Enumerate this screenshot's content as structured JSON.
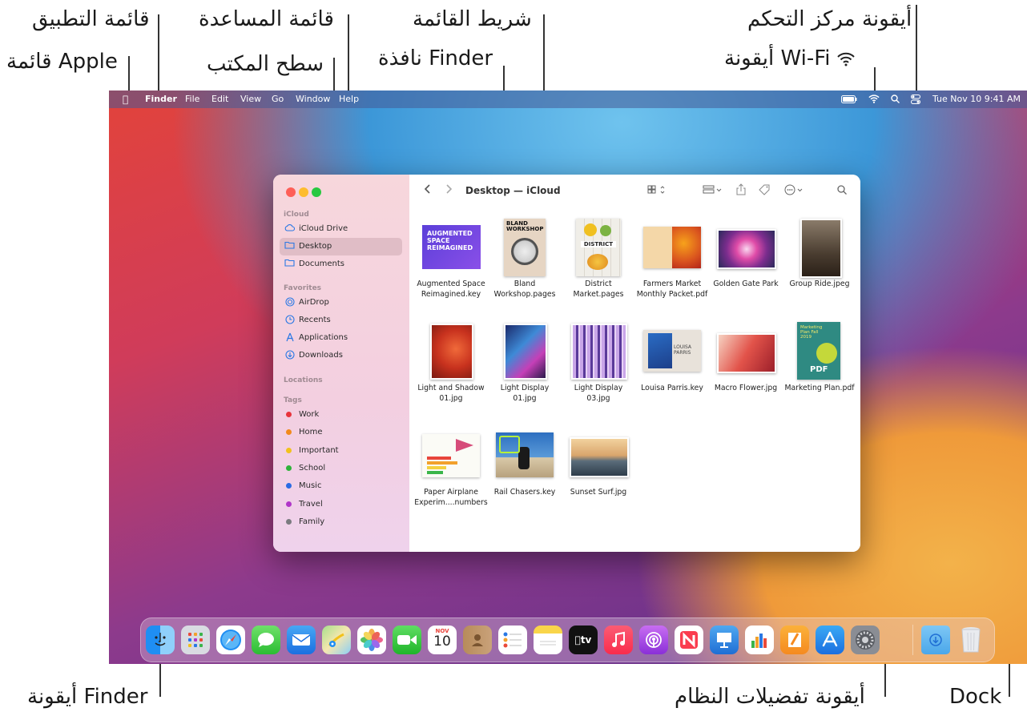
{
  "callouts": {
    "app_menu": "قائمة التطبيق",
    "help_menu": "قائمة المساعدة",
    "menu_bar": "شريط القائمة",
    "control_center_icon": "أيقونة مركز التحكم",
    "apple_menu": "قائمة Apple",
    "desktop": "سطح المكتب",
    "finder_window": "نافذة Finder",
    "wifi_icon": "أيقونة Wi-Fi",
    "finder_icon": "أيقونة Finder",
    "system_prefs_icon": "أيقونة تفضيلات النظام",
    "dock": "Dock"
  },
  "menubar": {
    "app": "Finder",
    "items": [
      "File",
      "Edit",
      "View",
      "Go",
      "Window",
      "Help"
    ],
    "datetime": "Tue Nov 10  9:41 AM"
  },
  "finder": {
    "title": "Desktop — iCloud",
    "sidebar": {
      "icloud_header": "iCloud",
      "icloud": [
        "iCloud Drive",
        "Desktop",
        "Documents"
      ],
      "favorites_header": "Favorites",
      "favorites": [
        "AirDrop",
        "Recents",
        "Applications",
        "Downloads"
      ],
      "locations_header": "Locations",
      "tags_header": "Tags",
      "tags": [
        {
          "label": "Work",
          "color": "#e8333b"
        },
        {
          "label": "Home",
          "color": "#f28a1c"
        },
        {
          "label": "Important",
          "color": "#f2c21c"
        },
        {
          "label": "School",
          "color": "#2fb23a"
        },
        {
          "label": "Music",
          "color": "#2a6be4"
        },
        {
          "label": "Travel",
          "color": "#b036c8"
        },
        {
          "label": "Family",
          "color": "#7b7b80"
        }
      ]
    },
    "files": [
      {
        "l1": "Augmented Space",
        "l2": "Reimagined.key"
      },
      {
        "l1": "Bland",
        "l2": "Workshop.pages"
      },
      {
        "l1": "District",
        "l2": "Market.pages"
      },
      {
        "l1": "Farmers Market",
        "l2": "Monthly Packet.pdf"
      },
      {
        "l1": "Golden Gate Park",
        "l2": ""
      },
      {
        "l1": "Group Ride.jpeg",
        "l2": ""
      },
      {
        "l1": "Light and Shadow",
        "l2": "01.jpg"
      },
      {
        "l1": "Light Display",
        "l2": "01.jpg"
      },
      {
        "l1": "Light Display",
        "l2": "03.jpg"
      },
      {
        "l1": "Louisa Parris.key",
        "l2": ""
      },
      {
        "l1": "Macro Flower.jpg",
        "l2": ""
      },
      {
        "l1": "Marketing Plan.pdf",
        "l2": ""
      },
      {
        "l1": "Paper Airplane",
        "l2": "Experim....numbers"
      },
      {
        "l1": "Rail Chasers.key",
        "l2": ""
      },
      {
        "l1": "Sunset Surf.jpg",
        "l2": ""
      }
    ],
    "thumb_text": {
      "augmented": "AUGMENTED SPACE REIMAGINED",
      "bland": "BLAND WORKSHOP",
      "district": "DISTRICT",
      "louisa": "LOUISA PARRIS",
      "marketing": "Marketing Plan Fall 2019",
      "pdf": "PDF"
    }
  },
  "dock": {
    "calendar_month": "NOV",
    "calendar_day": "10",
    "tv_label": "tv"
  }
}
